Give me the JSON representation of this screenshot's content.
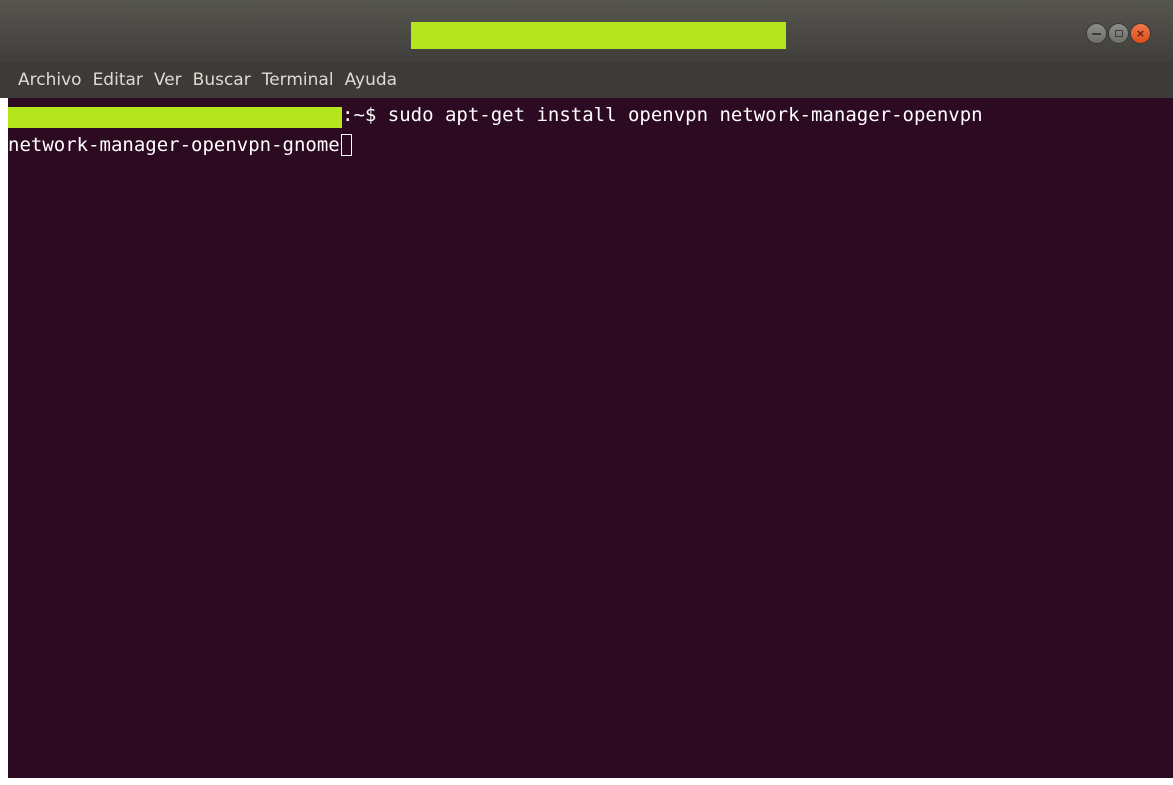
{
  "colors": {
    "redaction": "#b5e61d",
    "terminal_background": "#2c0a21",
    "titlebar": "#46453f",
    "menubar": "#3c3b37",
    "text": "#ffffff"
  },
  "window": {
    "controls": {
      "minimize_icon": "minimize-icon",
      "maximize_icon": "maximize-icon",
      "close_icon": "close-icon",
      "close_glyph": "×"
    }
  },
  "menu": {
    "items": [
      "Archivo",
      "Editar",
      "Ver",
      "Buscar",
      "Terminal",
      "Ayuda"
    ]
  },
  "terminal": {
    "line1": ":~$ sudo apt-get install openvpn network-manager-openvpn",
    "line2": "network-manager-openvpn-gnome"
  }
}
